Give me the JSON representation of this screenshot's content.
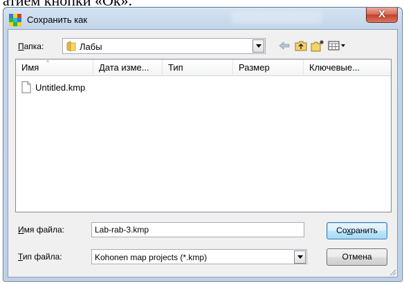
{
  "background_text": "атием кнопки «Ок».",
  "window": {
    "title": "Сохранить как",
    "close_glyph": "X"
  },
  "toolbar": {
    "folder_label_accel": "П",
    "folder_label_rest": "апка:",
    "folder_name": "Лабы",
    "icons": [
      "back-arrow-icon",
      "up-folder-icon",
      "new-folder-icon",
      "view-menu-icon"
    ]
  },
  "file_list": {
    "columns": [
      "Имя",
      "Дата изме...",
      "Тип",
      "Размер",
      "Ключевые..."
    ],
    "items": [
      {
        "name": "Untitled.kmp",
        "icon": "document-icon"
      }
    ]
  },
  "filename": {
    "label_accel": "И",
    "label_rest": "мя файла:",
    "value": "Lab-rab-3.kmp"
  },
  "filetype": {
    "label_accel": "Т",
    "label_rest": "ип файла:",
    "value": "Kohonen map projects (*.kmp)"
  },
  "buttons": {
    "save_pre": "Со",
    "save_accel": "х",
    "save_post": "ранить",
    "cancel": "Отмена"
  },
  "colors": {
    "title_gradient_top": "#d6e4f3",
    "close_red": "#c2412a",
    "client_bg": "#f0f0f0",
    "default_button_blue": "#3c7fb1"
  }
}
